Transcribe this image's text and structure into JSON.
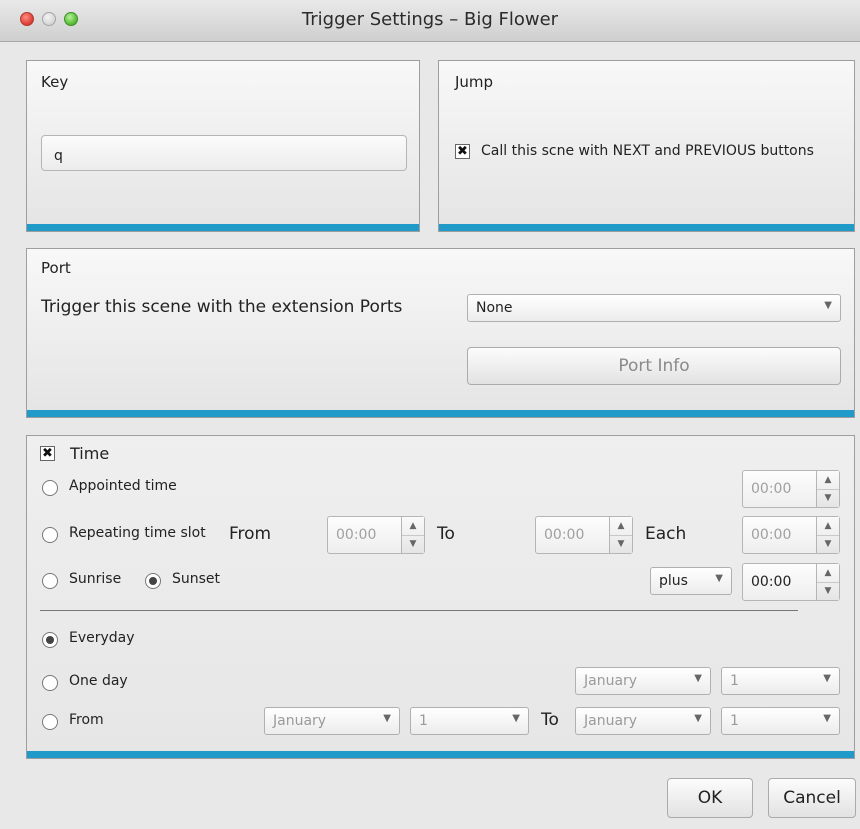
{
  "window": {
    "title": "Trigger Settings – Big Flower"
  },
  "key": {
    "title": "Key",
    "value": "q"
  },
  "jump": {
    "title": "Jump",
    "checkbox_label": "Call this scne with NEXT and PREVIOUS buttons",
    "checked": true
  },
  "port": {
    "title": "Port",
    "trigger_label": "Trigger this scene with the extension Ports",
    "selected": "None",
    "info_button": "Port Info"
  },
  "time": {
    "title": "Time",
    "checked": true,
    "appointed_label": "Appointed time",
    "appointed_value": "00:00",
    "repeating_label": "Repeating time slot",
    "from_label": "From",
    "from_value": "00:00",
    "to_label": "To",
    "to_value": "00:00",
    "each_label": "Each",
    "each_value": "00:00",
    "sunrise_label": "Sunrise",
    "sunset_label": "Sunset",
    "sun_mode": "sunset",
    "offset_sign": "plus",
    "offset_value": "00:00",
    "everyday_label": "Everyday",
    "day_mode": "everyday",
    "oneday_label": "One day",
    "oneday_month": "January",
    "oneday_day": "1",
    "range_from_label": "From",
    "range_from_month": "January",
    "range_from_day": "1",
    "range_to_label": "To",
    "range_to_month": "January",
    "range_to_day": "1"
  },
  "footer": {
    "ok": "OK",
    "cancel": "Cancel"
  }
}
